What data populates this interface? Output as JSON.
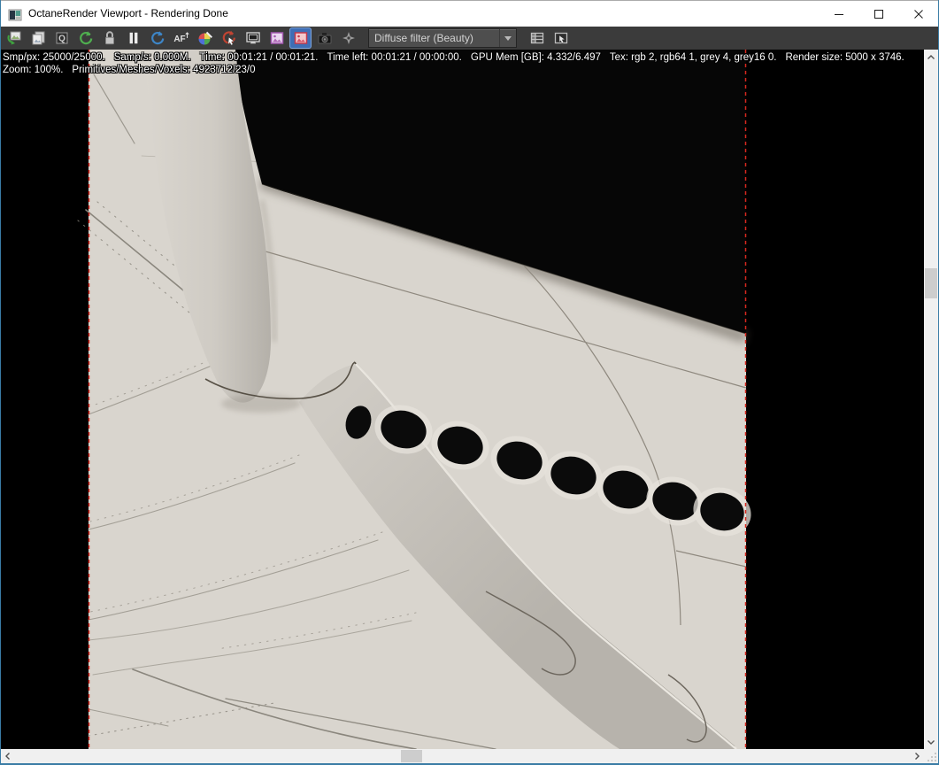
{
  "window": {
    "title": "OctaneRender Viewport - Rendering Done",
    "controls": {
      "minimize": "minimize",
      "maximize": "maximize",
      "close": "close"
    }
  },
  "toolbar": {
    "icons": [
      {
        "name": "save-render-icon"
      },
      {
        "name": "copy-image-icon"
      },
      {
        "name": "pick-zoom-icon"
      },
      {
        "name": "restart-render-icon"
      },
      {
        "name": "lock-resolution-icon"
      },
      {
        "name": "pause-render-icon"
      },
      {
        "name": "refresh-render-icon"
      },
      {
        "name": "autofocus-pick-icon"
      },
      {
        "name": "white-balance-picker-icon"
      },
      {
        "name": "region-redraw-icon"
      },
      {
        "name": "fit-to-viewport-icon"
      },
      {
        "name": "film-region-icon"
      },
      {
        "name": "render-region-icon",
        "selected": true
      },
      {
        "name": "camera-snapshot-icon"
      },
      {
        "name": "denoise-toggle-icon"
      },
      {
        "name": "render-passes-icon"
      },
      {
        "name": "object-picker-icon"
      }
    ],
    "render_pass_dropdown": {
      "value": "Diffuse filter (Beauty)"
    }
  },
  "status_overlay": {
    "line1": [
      "Smp/px: 25000/25000.",
      "Samp/s: 0.000M.",
      "Time: 00:01:21 / 00:01:21.",
      "Time left: 00:01:21 / 00:00:00.",
      "GPU Mem [GB]: 4.332/6.497",
      "Tex: rgb 2, rgb64 1, grey 4, grey16 0.",
      "Render size: 5000 x 3746."
    ],
    "line2": [
      "Zoom: 100%.",
      "Primitives/Meshes/Voxels: 4923712/23/0"
    ]
  },
  "viewport": {
    "scene": "close-up render of an airliner fuselage with a row of passenger windows, wing surface with panel lines and a flap-track fairing, on a black background",
    "film_region_border_color": "#d8281e",
    "background_color": "#000000",
    "render_base_color": "#d9d5ce"
  },
  "colors": {
    "titlebar_bg": "#ffffff",
    "toolbar_bg": "#3b3b3b",
    "selected_tool_bg": "#3e6eb5",
    "scrollbar_track": "#f0f0f0",
    "scrollbar_thumb": "#cdcdcd",
    "window_border": "#3a7ca5"
  }
}
